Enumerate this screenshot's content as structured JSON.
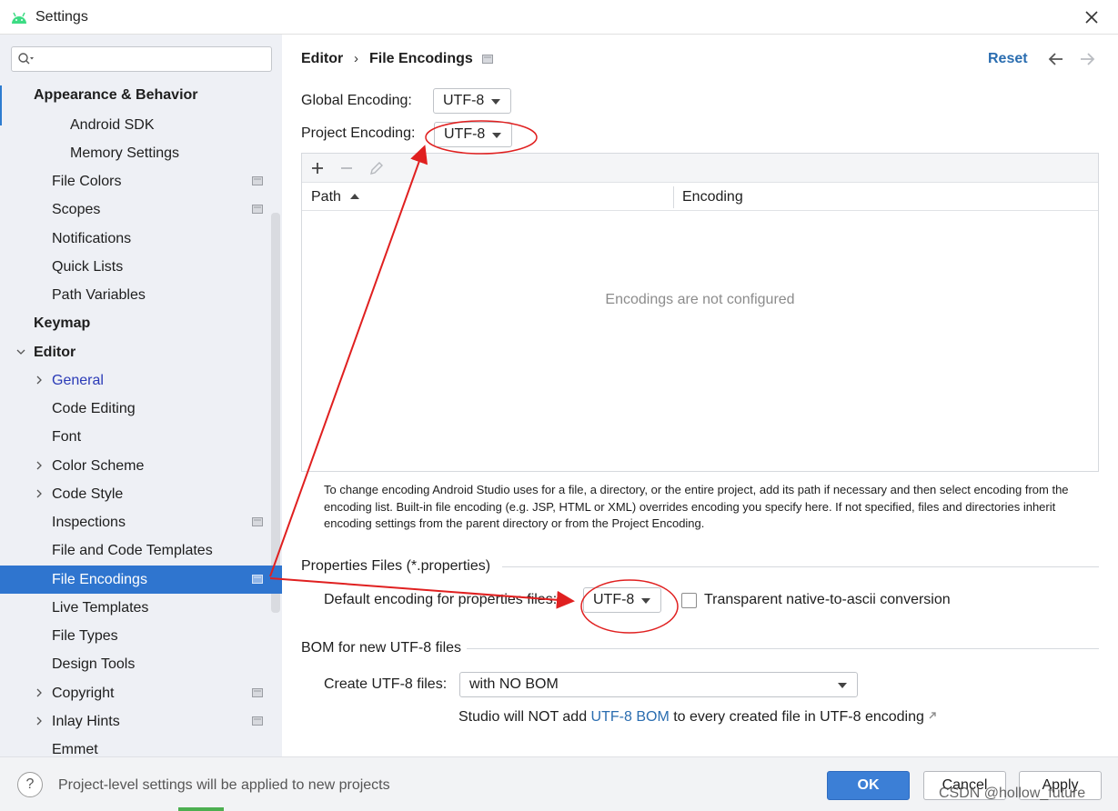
{
  "window": {
    "title": "Settings",
    "app_icon": "android-icon",
    "close_icon": "close-icon"
  },
  "sidebar": {
    "search": {
      "value": "",
      "placeholder": ""
    },
    "items": [
      {
        "label": "Appearance & Behavior",
        "bold": true
      },
      {
        "label": "Android SDK"
      },
      {
        "label": "Memory Settings"
      },
      {
        "label": "File Colors",
        "icon": "page-icon"
      },
      {
        "label": "Scopes",
        "icon": "page-icon"
      },
      {
        "label": "Notifications"
      },
      {
        "label": "Quick Lists"
      },
      {
        "label": "Path Variables"
      },
      {
        "label": "Keymap",
        "bold": true
      },
      {
        "label": "Editor",
        "bold": true,
        "expanded": true
      },
      {
        "label": "General",
        "expandable": true
      },
      {
        "label": "Code Editing"
      },
      {
        "label": "Font"
      },
      {
        "label": "Color Scheme",
        "expandable": true
      },
      {
        "label": "Code Style",
        "expandable": true
      },
      {
        "label": "Inspections",
        "icon": "page-icon"
      },
      {
        "label": "File and Code Templates"
      },
      {
        "label": "File Encodings",
        "selected": true,
        "icon": "page-icon"
      },
      {
        "label": "Live Templates"
      },
      {
        "label": "File Types"
      },
      {
        "label": "Design Tools"
      },
      {
        "label": "Copyright",
        "expandable": true,
        "icon": "page-icon"
      },
      {
        "label": "Inlay Hints",
        "expandable": true,
        "icon": "page-icon"
      },
      {
        "label": "Emmet"
      }
    ]
  },
  "header": {
    "breadcrumb_parent": "Editor",
    "breadcrumb_separator": "›",
    "breadcrumb_current": "File Encodings",
    "reset_label": "Reset"
  },
  "encodings": {
    "global_label": "Global Encoding:",
    "global_value": "UTF-8",
    "project_label": "Project Encoding:",
    "project_value": "UTF-8"
  },
  "table": {
    "col_path": "Path",
    "col_encoding": "Encoding",
    "empty_text": "Encodings are not configured"
  },
  "help_text": "To change encoding Android Studio uses for a file, a directory, or the entire project, add its path if necessary and then select encoding from the encoding list. Built-in file encoding (e.g. JSP, HTML or XML) overrides encoding you specify here. If not specified, files and directories inherit encoding settings from the parent directory or from the Project Encoding.",
  "properties": {
    "section_title": "Properties Files (*.properties)",
    "default_label": "Default encoding for properties files:",
    "default_value": "UTF-8",
    "checkbox_label": "Transparent native-to-ascii conversion",
    "checkbox_checked": false
  },
  "bom": {
    "section_title": "BOM for new UTF-8 files",
    "create_label": "Create UTF-8 files:",
    "create_value": "with NO BOM",
    "note_prefix": "Studio will NOT add ",
    "note_link": "UTF-8 BOM",
    "note_suffix": " to every created file in UTF-8 encoding"
  },
  "footer": {
    "note": "Project-level settings will be applied to new projects",
    "help_label": "?",
    "ok_label": "OK",
    "cancel_label": "Cancel",
    "apply_label": "Apply",
    "watermark": "CSDN @hollow_future"
  },
  "colors": {
    "selection": "#2f75cf",
    "link": "#2a6db0",
    "annotation": "#e02020",
    "ok_button": "#3c7fd6"
  }
}
